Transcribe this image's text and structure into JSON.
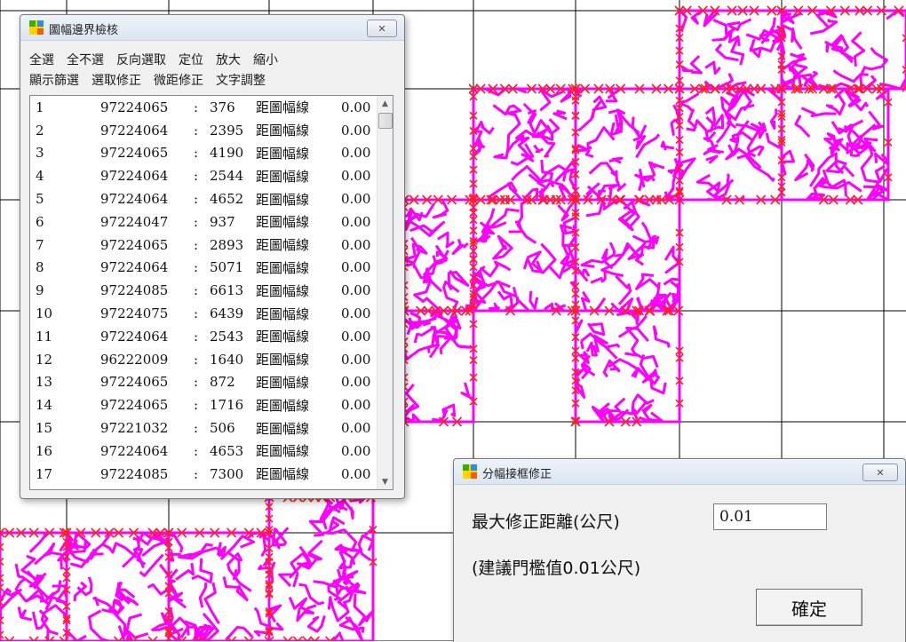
{
  "map": {
    "line_color": "#ff00ff",
    "marker_color": "#ff2020",
    "grid_color": "#000000"
  },
  "check_window": {
    "title": "圖幅邊界檢核",
    "icon": "app-logo-icon",
    "menu_row1": [
      "全選",
      "全不選",
      "反向選取",
      "定位",
      "放大",
      "縮小"
    ],
    "menu_row2": [
      "顯示篩選",
      "選取修正",
      "微距修正",
      "文字調整"
    ],
    "distance_label": "距圖幅線",
    "rows": [
      {
        "num": "1",
        "id": "97224065",
        "val": "376",
        "dist": "0.00"
      },
      {
        "num": "2",
        "id": "97224064",
        "val": "2395",
        "dist": "0.00"
      },
      {
        "num": "3",
        "id": "97224065",
        "val": "4190",
        "dist": "0.00"
      },
      {
        "num": "4",
        "id": "97224064",
        "val": "2544",
        "dist": "0.00"
      },
      {
        "num": "5",
        "id": "97224064",
        "val": "4652",
        "dist": "0.00"
      },
      {
        "num": "6",
        "id": "97224047",
        "val": "937",
        "dist": "0.00"
      },
      {
        "num": "7",
        "id": "97224065",
        "val": "2893",
        "dist": "0.00"
      },
      {
        "num": "8",
        "id": "97224064",
        "val": "5071",
        "dist": "0.00"
      },
      {
        "num": "9",
        "id": "97224085",
        "val": "6613",
        "dist": "0.00"
      },
      {
        "num": "10",
        "id": "97224075",
        "val": "6439",
        "dist": "0.00"
      },
      {
        "num": "11",
        "id": "97224064",
        "val": "2543",
        "dist": "0.00"
      },
      {
        "num": "12",
        "id": "96222009",
        "val": "1640",
        "dist": "0.00"
      },
      {
        "num": "13",
        "id": "97224065",
        "val": "872",
        "dist": "0.00"
      },
      {
        "num": "14",
        "id": "97224065",
        "val": "1716",
        "dist": "0.00"
      },
      {
        "num": "15",
        "id": "97221032",
        "val": "506",
        "dist": "0.00"
      },
      {
        "num": "16",
        "id": "97224064",
        "val": "4653",
        "dist": "0.00"
      },
      {
        "num": "17",
        "id": "97224085",
        "val": "7300",
        "dist": "0.00"
      }
    ]
  },
  "fix_window": {
    "title": "分幅接框修正",
    "max_distance_label": "最大修正距離(公尺)",
    "max_distance_value": "0.01",
    "hint": "(建議門檻值0.01公尺)",
    "ok_label": "確定"
  }
}
